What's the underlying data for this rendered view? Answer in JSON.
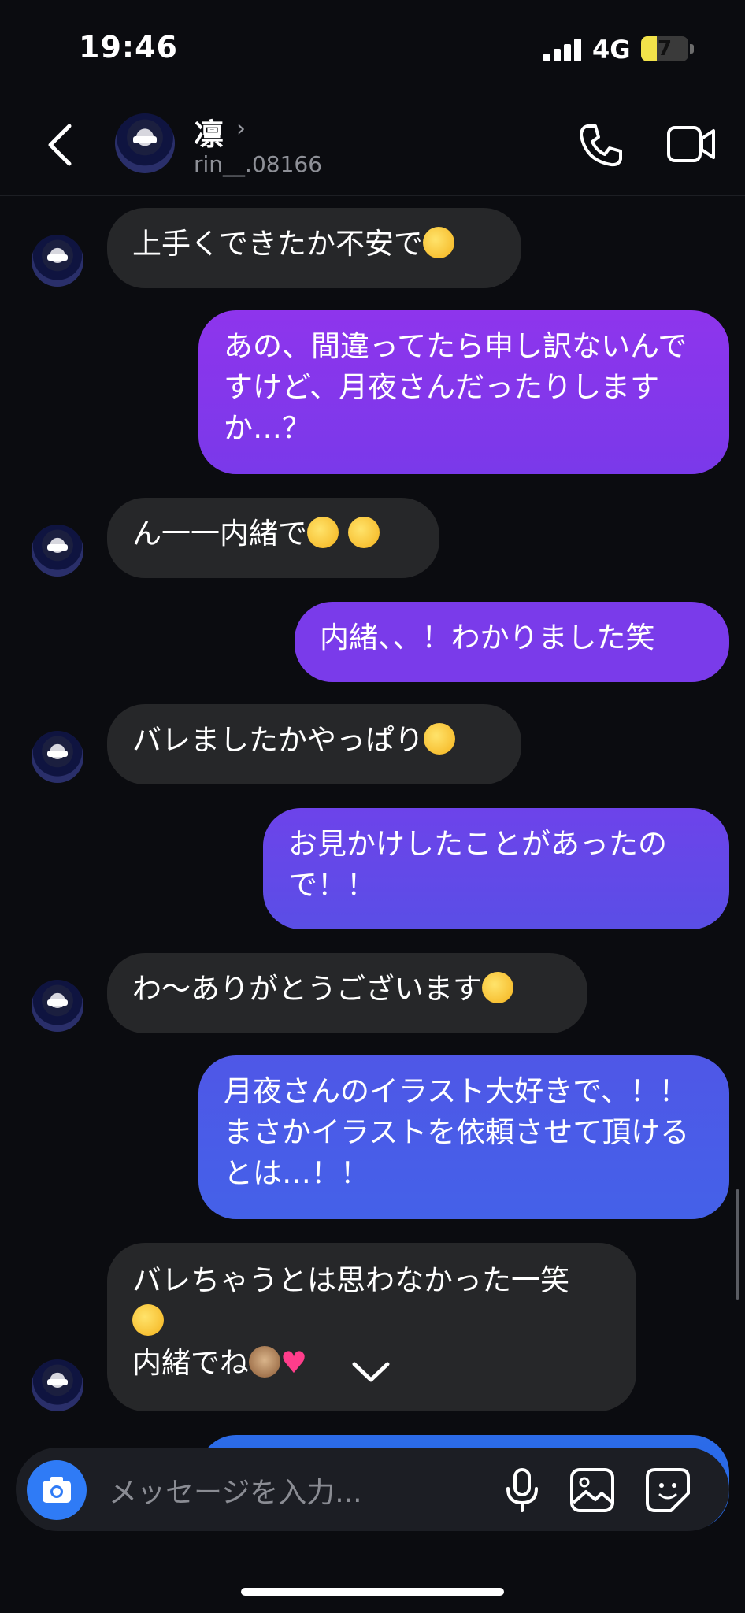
{
  "status_bar": {
    "time": "19:46",
    "network": "4G",
    "battery_level": 7,
    "battery_color": "#f2e24a"
  },
  "header": {
    "name": "凛",
    "username": "rin__.08166"
  },
  "messages": [
    {
      "side": "in",
      "text": "上手くできたか不安で",
      "emoji": "crying-face"
    },
    {
      "side": "out",
      "text": "あの、間違ってたら申し訳ないんですけど、月夜さんだったりしますか…？"
    },
    {
      "side": "in",
      "text": "ん一一内緒で",
      "emoji": "shushing-face hand-over-mouth-face"
    },
    {
      "side": "out",
      "text": "内緒、、！わかりました笑"
    },
    {
      "side": "in",
      "text": "バレましたかやっぱり",
      "emoji": "relieved-face"
    },
    {
      "side": "out",
      "text": "お見かけしたことがあったので！！"
    },
    {
      "side": "in",
      "text": "わ〜ありがとうございます",
      "emoji": "tears-of-joy-face"
    },
    {
      "side": "out",
      "text": "月夜さんのイラスト大好きで、！！　まさかイラストを依頼させて頂けるとは…！！"
    },
    {
      "side": "in",
      "text_line1": "バレちゃうとは思わなかった一笑",
      "text_line2": "内緒でね",
      "emoji": "tears-of-joy-face see-no-evil-monkey heart"
    }
  ],
  "composer": {
    "placeholder": "メッセージを入力..."
  },
  "colors": {
    "incoming": "#262729",
    "outgoing_top": "#8e35ec",
    "outgoing_bottom": "#2468e6",
    "camera": "#2f7bf6"
  }
}
